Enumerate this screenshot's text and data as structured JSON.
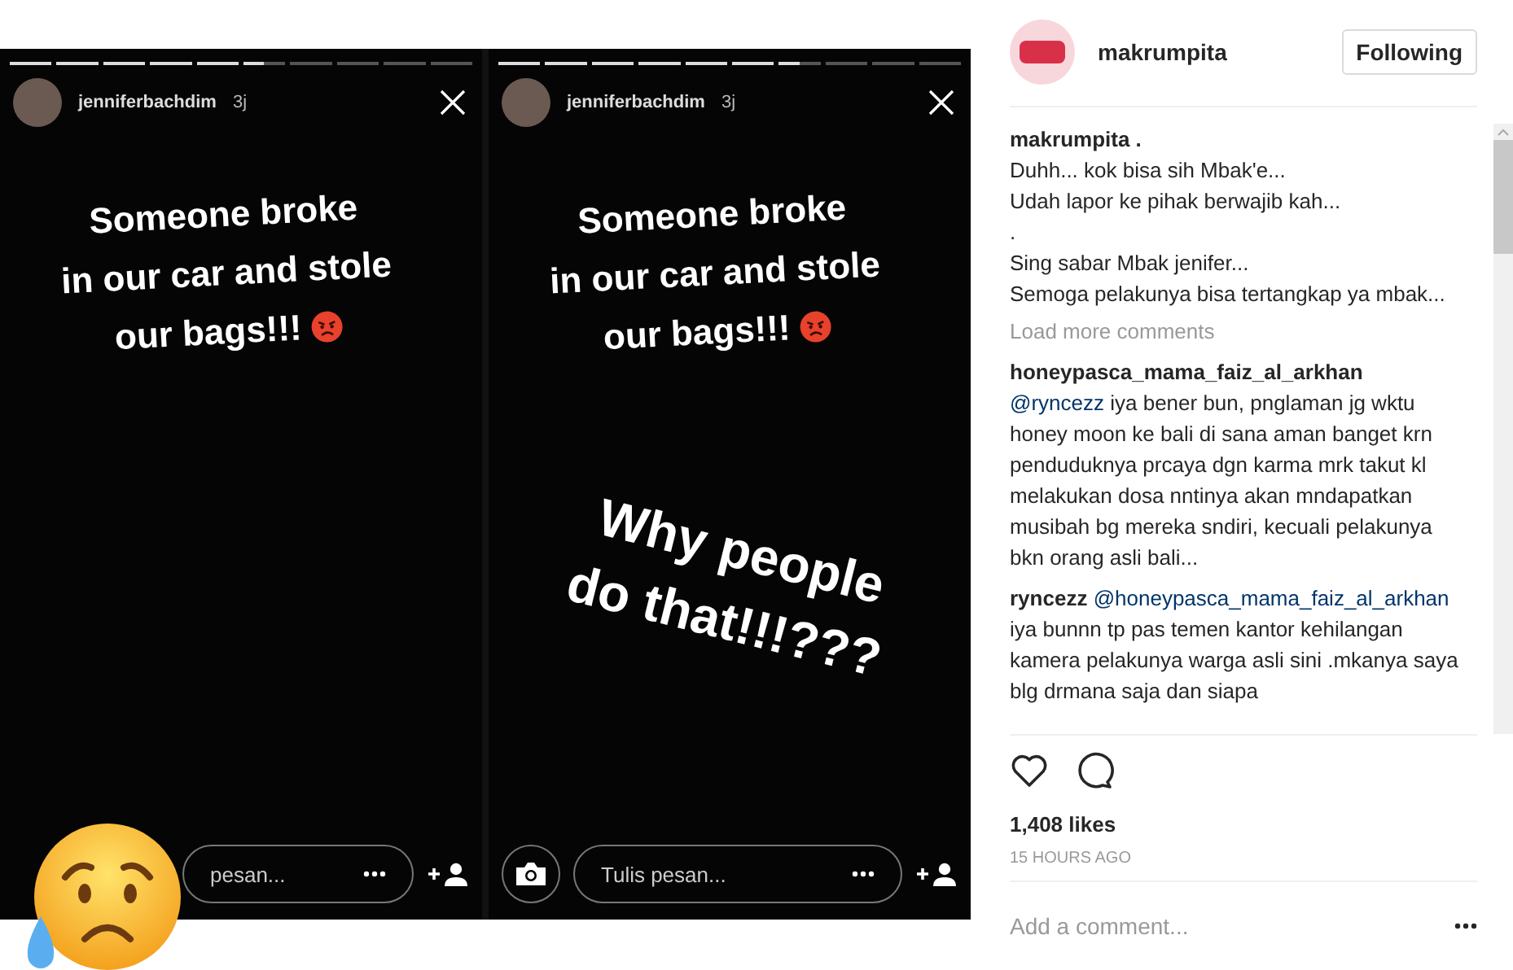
{
  "post_image": {
    "stories": [
      {
        "user": "jenniferbachdim",
        "time": "3j",
        "level": 0.55,
        "stickers": [
          {
            "kind": "text",
            "lines": [
              "Someone broke",
              "in our car and stole",
              "our bags!!!"
            ],
            "angry_emoji": true
          }
        ],
        "camera_button": false,
        "message_placeholder": "pesan..."
      },
      {
        "user": "jenniferbachdim",
        "time": "3j",
        "level": 0.65,
        "stickers": [
          {
            "kind": "text",
            "lines": [
              "Someone broke",
              "in our car and stole",
              "our bags!!!"
            ],
            "angry_emoji": true
          },
          {
            "kind": "text",
            "lines": [
              "Why people",
              "do that!!!???"
            ]
          }
        ],
        "camera_button": true,
        "message_placeholder": "Tulis pesan..."
      }
    ],
    "overlay": {
      "kind": "sad-emoji"
    }
  },
  "header": {
    "user": "makrumpita",
    "follow_button": "Following"
  },
  "comments": [
    {
      "user": "makrumpita .",
      "text": "Duhh... kok bisa sih Mbak'e...\nUdah lapor ke pihak berwajib kah...\n.\nSing sabar Mbak jenifer...\nSemoga pelakunya bisa tertangkap ya mbak..."
    },
    {
      "kind": "load-more",
      "label": "Load more comments"
    },
    {
      "user": "honeypasca_mama_faiz_al_arkhan",
      "mention": "@ryncezz",
      "text": "iya bener bun, pnglaman jg wktu honey moon ke bali di sana aman banget krn penduduknya prcaya dgn karma mrk takut kl melakukan dosa nntinya akan mndapatkan musibah bg mereka sndiri, kecuali pelakunya bkn orang asli bali..."
    },
    {
      "user": "ryncezz",
      "mention": "@honeypasca_mama_faiz_al_arkhan",
      "text": "iya bunnn tp pas temen kantor kehilangan kamera pelakunya warga asli sini .mkanya saya blg drmana saja dan siapa"
    }
  ],
  "actions": {
    "liked": false
  },
  "likes": "1,408 likes",
  "time": "15 HOURS AGO",
  "comment_field": {
    "placeholder": "Add a comment..."
  }
}
